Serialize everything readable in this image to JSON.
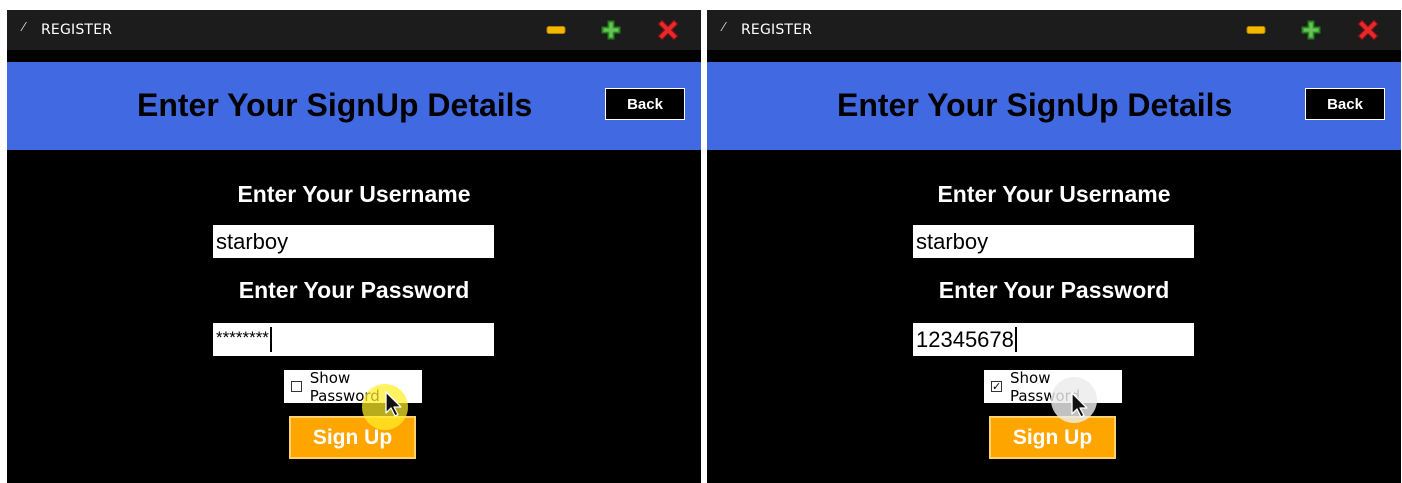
{
  "colors": {
    "titlebar": "#1c1c1c",
    "header": "#4169e1",
    "body": "#000000",
    "signup_button": "#ffa500",
    "minimize_icon": "#f5b800",
    "maximize_icon": "#3fa535",
    "close_icon": "#e8292c"
  },
  "windows": [
    {
      "title": "REGISTER",
      "heading": "Enter Your SignUp Details",
      "back_label": "Back",
      "username_label": "Enter Your Username",
      "username_value": "starboy",
      "password_label": "Enter Your Password",
      "password_value": "********",
      "show_password_label": "Show Password",
      "show_password_checked": false,
      "signup_label": "Sign Up",
      "icons": [
        "feather-icon",
        "minimize-icon",
        "maximize-icon",
        "close-icon",
        "mouse-cursor-icon"
      ]
    },
    {
      "title": "REGISTER",
      "heading": "Enter Your SignUp Details",
      "back_label": "Back",
      "username_label": "Enter Your Username",
      "username_value": "starboy",
      "password_label": "Enter Your Password",
      "password_value": "12345678",
      "show_password_label": "Show Password",
      "show_password_checked": true,
      "check_glyph": "✓",
      "signup_label": "Sign Up",
      "icons": [
        "feather-icon",
        "minimize-icon",
        "maximize-icon",
        "close-icon",
        "mouse-cursor-icon"
      ]
    }
  ]
}
